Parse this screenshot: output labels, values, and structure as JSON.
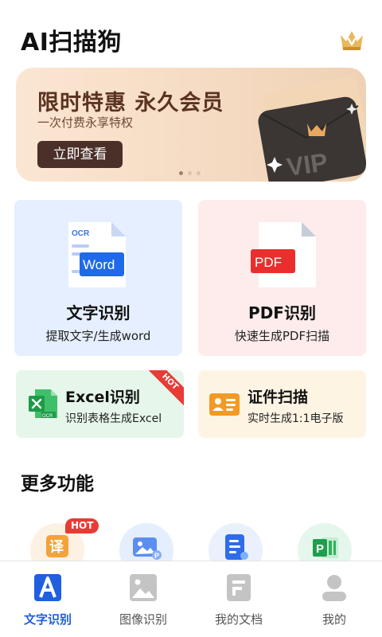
{
  "app": {
    "title": "AI扫描狗",
    "crown_icon": "crown-icon"
  },
  "banner": {
    "title": "限时特惠 永久会员",
    "subtitle": "一次付费永享特权",
    "button": "立即查看",
    "card_text": "VIP",
    "page_count": 3,
    "active_page": 1
  },
  "features": {
    "ocr": {
      "title": "文字识别",
      "subtitle": "提取文字/生成word",
      "icon_tag": "OCR",
      "icon_label": "Word"
    },
    "pdf": {
      "title": "PDF识别",
      "subtitle": "快速生成PDF扫描",
      "icon_label": "PDF"
    },
    "excel": {
      "title": "Excel识别",
      "subtitle": "识别表格生成Excel",
      "ribbon": "HOT",
      "icon_tag": "OCR"
    },
    "id_scan": {
      "title": "证件扫描",
      "subtitle": "实时生成1:1电子版"
    }
  },
  "more": {
    "title": "更多功能",
    "hot_badge": "HOT",
    "items": [
      {
        "icon": "translate-icon",
        "glyph": "译"
      },
      {
        "icon": "image-icon"
      },
      {
        "icon": "document-icon"
      },
      {
        "icon": "spreadsheet-icon",
        "glyph": "P"
      }
    ]
  },
  "tabs": [
    {
      "label": "文字识别",
      "icon": "text-a-icon",
      "active": true
    },
    {
      "label": "图像识别",
      "icon": "image-icon",
      "active": false
    },
    {
      "label": "我的文档",
      "icon": "document-icon",
      "active": false
    },
    {
      "label": "我的",
      "icon": "user-icon",
      "active": false
    }
  ],
  "colors": {
    "accent": "#1f5fe0",
    "hot": "#e83b36",
    "banner_button": "#4a3028"
  }
}
